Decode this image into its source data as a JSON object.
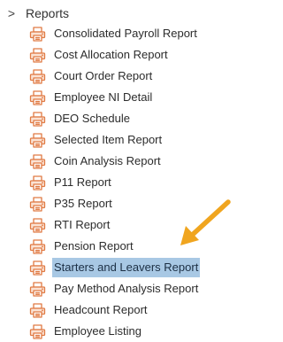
{
  "tree": {
    "section_label": "Reports",
    "items": [
      {
        "label": "Consolidated Payroll Report",
        "selected": false
      },
      {
        "label": "Cost Allocation Report",
        "selected": false
      },
      {
        "label": "Court Order Report",
        "selected": false
      },
      {
        "label": "Employee NI Detail",
        "selected": false
      },
      {
        "label": "DEO Schedule",
        "selected": false
      },
      {
        "label": "Selected Item Report",
        "selected": false
      },
      {
        "label": "Coin Analysis Report",
        "selected": false
      },
      {
        "label": "P11 Report",
        "selected": false
      },
      {
        "label": "P35 Report",
        "selected": false
      },
      {
        "label": "RTI Report",
        "selected": false
      },
      {
        "label": "Pension Report",
        "selected": false
      },
      {
        "label": "Starters and Leavers Report",
        "selected": true
      },
      {
        "label": "Pay Method Analysis Report",
        "selected": false
      },
      {
        "label": "Headcount Report",
        "selected": false
      },
      {
        "label": "Employee Listing",
        "selected": false
      }
    ]
  },
  "colors": {
    "icon": "#e07a43",
    "selection": "#a8c8e4",
    "arrow": "#f0a51f"
  }
}
